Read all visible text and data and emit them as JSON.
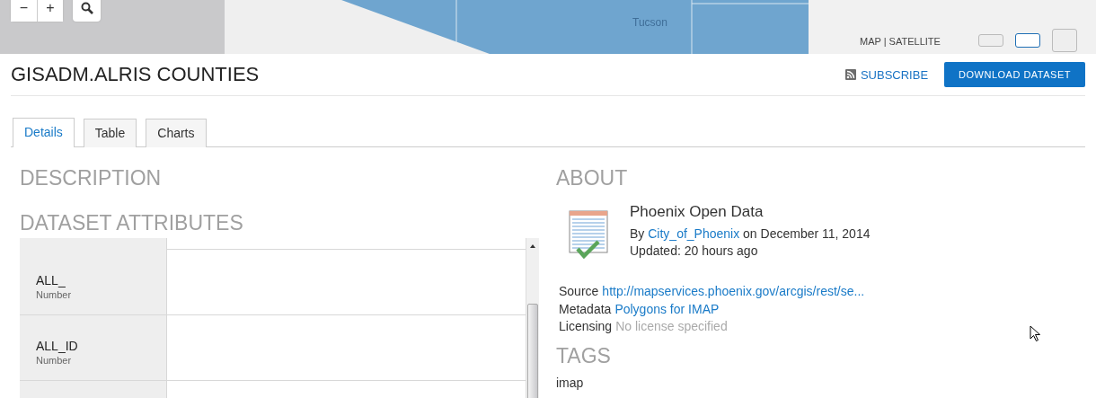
{
  "map": {
    "zoom_buttons": [
      "−",
      "+"
    ],
    "place_label": "Tucson",
    "basemap_label": "MAP | SATELLITE",
    "size_options": [
      {
        "selected": false
      },
      {
        "selected": true
      },
      {
        "selected": false
      }
    ]
  },
  "header": {
    "title": "GISADM.ALRIS COUNTIES",
    "subscribe": "SUBSCRIBE",
    "download": "DOWNLOAD DATASET"
  },
  "tabs": [
    {
      "label": "Details",
      "selected": true
    },
    {
      "label": "Table",
      "selected": false
    },
    {
      "label": "Charts",
      "selected": false
    }
  ],
  "description": {
    "heading": "DESCRIPTION"
  },
  "attributes": {
    "heading": "DATASET ATTRIBUTES",
    "rows": [
      {
        "name": "ALL_",
        "type": "Number"
      },
      {
        "name": "ALL_ID",
        "type": "Number"
      }
    ]
  },
  "about": {
    "heading": "ABOUT",
    "owner": "Phoenix Open Data",
    "by": "By",
    "author": "City_of_Phoenix",
    "date": "on December 11, 2014",
    "updated": "Updated: 20 hours ago",
    "fields": [
      {
        "label": "Source",
        "value": "http://mapservices.phoenix.gov/arcgis/rest/se...",
        "kind": "link"
      },
      {
        "label": "Metadata",
        "value": "Polygons for IMAP",
        "kind": "link"
      },
      {
        "label": "Licensing",
        "value": "No license specified",
        "kind": "muted"
      }
    ]
  },
  "tags": {
    "heading": "TAGS",
    "items": [
      "imap"
    ]
  }
}
